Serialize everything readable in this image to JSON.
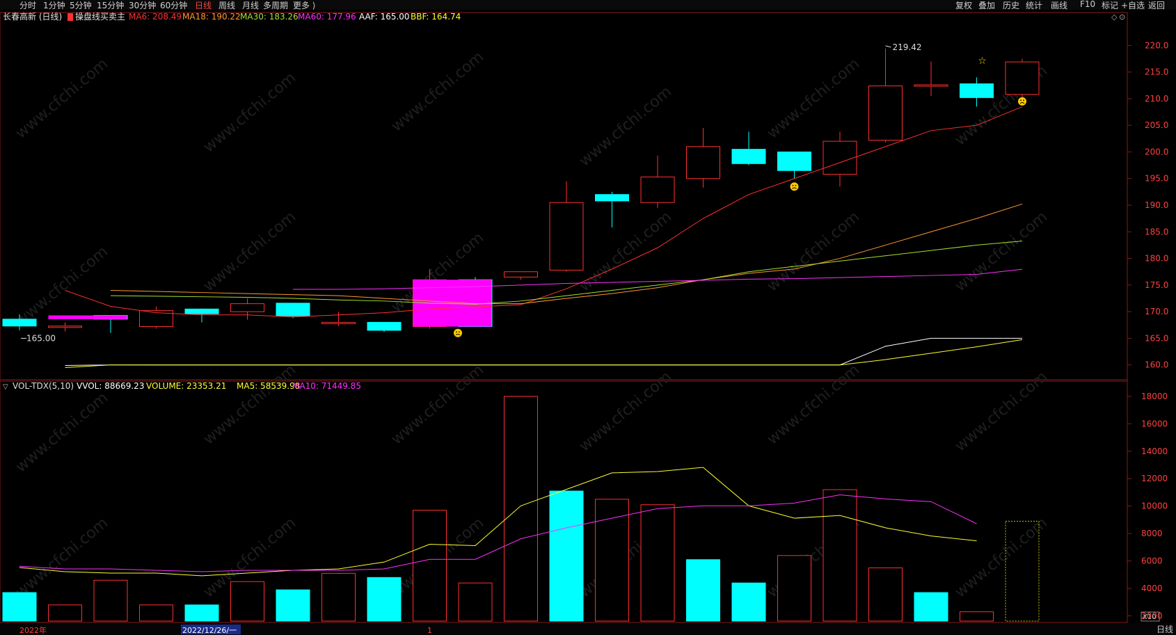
{
  "toolbar": {
    "periods": [
      "分时",
      "1分钟",
      "5分钟",
      "15分钟",
      "30分钟",
      "60分钟",
      "日线",
      "周线",
      "月线",
      "多周期",
      "更多 ⟩"
    ],
    "active": "日线",
    "right_items": [
      "复权",
      "叠加",
      "历史",
      "统计",
      "画线",
      "F10",
      "标记",
      "+自选",
      "返回"
    ]
  },
  "main_legend": {
    "stock": "长春高新 (日线)",
    "indicator": "操盘线买卖主",
    "items": [
      {
        "label": "MA6: 208.49",
        "color": "#ff3030"
      },
      {
        "label": "MA18: 190.22",
        "color": "#ff9a30"
      },
      {
        "label": "MA30: 183.26",
        "color": "#a8e030"
      },
      {
        "label": "MA60: 177.96",
        "color": "#ff30ff"
      },
      {
        "label": "AAF: 165.00",
        "color": "#ffffff"
      },
      {
        "label": "BBF: 164.74",
        "color": "#ffff30"
      }
    ]
  },
  "vol_legend": {
    "name": "VOL-TDX(5,10)",
    "items": [
      {
        "label": "VVOL: 88669.23",
        "color": "#ffffff"
      },
      {
        "label": "VOLUME: 23353.21",
        "color": "#ffff30"
      },
      {
        "label": "MA5: 58539.98",
        "color": "#ffff30"
      },
      {
        "label": "MA10: 71449.85",
        "color": "#ff30ff"
      }
    ]
  },
  "annotations": {
    "high_label": "219.42",
    "low_label": "165.00"
  },
  "watermark": "www.cfchi.com",
  "x_axis": {
    "labels": [
      "2022年",
      "2022/12/26/一",
      "1"
    ]
  },
  "bottom_tag": "日线",
  "scale_tag": "X10",
  "chart_data": [
    {
      "type": "candlestick",
      "ylim": [
        158,
        222
      ],
      "yticks": [
        160.0,
        165.0,
        170.0,
        175.0,
        180.0,
        185.0,
        190.0,
        195.0,
        200.0,
        205.0,
        210.0,
        215.0,
        220.0
      ],
      "candles": [
        {
          "o": 167.3,
          "c": 168.6,
          "h": 169.5,
          "l": 166.5,
          "dir": "down"
        },
        {
          "o": 167.2,
          "c": 167.3,
          "h": 168.0,
          "l": 166.3,
          "dir": "up"
        },
        {
          "o": 169.3,
          "c": 168.6,
          "h": 169.2,
          "l": 166.0,
          "dir": "down"
        },
        {
          "o": 167.2,
          "c": 170.2,
          "h": 171.0,
          "l": 166.8,
          "dir": "up"
        },
        {
          "o": 169.6,
          "c": 170.5,
          "h": 170.6,
          "l": 168.0,
          "dir": "down"
        },
        {
          "o": 170.0,
          "c": 171.5,
          "h": 172.5,
          "l": 168.5,
          "dir": "up"
        },
        {
          "o": 171.6,
          "c": 169.2,
          "h": 171.6,
          "l": 168.8,
          "dir": "down"
        },
        {
          "o": 168.0,
          "c": 168.0,
          "h": 170.0,
          "l": 167.3,
          "dir": "up"
        },
        {
          "o": 168.0,
          "c": 166.5,
          "h": 168.0,
          "l": 166.2,
          "dir": "down"
        },
        {
          "o": 167.2,
          "c": 176.0,
          "h": 178.0,
          "l": 166.8,
          "dir": "up"
        },
        {
          "o": 167.2,
          "c": 176.0,
          "h": 176.5,
          "l": 175.0,
          "dir": "down"
        },
        {
          "o": 177.5,
          "c": 176.5,
          "h": 177.0,
          "l": 176.0,
          "dir": "up"
        },
        {
          "o": 177.8,
          "c": 190.5,
          "h": 194.5,
          "l": 177.5,
          "dir": "up"
        },
        {
          "o": 192.0,
          "c": 190.8,
          "h": 192.5,
          "l": 185.8,
          "dir": "down"
        },
        {
          "o": 190.5,
          "c": 195.3,
          "h": 199.3,
          "l": 189.5,
          "dir": "up"
        },
        {
          "o": 195.0,
          "c": 201.0,
          "h": 204.5,
          "l": 193.3,
          "dir": "up"
        },
        {
          "o": 200.5,
          "c": 197.8,
          "h": 203.8,
          "l": 197.5,
          "dir": "down"
        },
        {
          "o": 200.0,
          "c": 196.5,
          "h": 200.0,
          "l": 195.0,
          "dir": "down"
        },
        {
          "o": 195.8,
          "c": 202.0,
          "h": 203.8,
          "l": 193.5,
          "dir": "up"
        },
        {
          "o": 202.2,
          "c": 212.4,
          "h": 219.4,
          "l": 201.8,
          "dir": "up"
        },
        {
          "o": 212.6,
          "c": 212.5,
          "h": 217.0,
          "l": 210.5,
          "dir": "up"
        },
        {
          "o": 212.8,
          "c": 210.2,
          "h": 214.0,
          "l": 208.5,
          "dir": "down"
        },
        {
          "o": 210.8,
          "c": 216.9,
          "h": 217.5,
          "l": 209.8,
          "dir": "up"
        }
      ],
      "series": [
        {
          "name": "MA6",
          "color": "#ff3030",
          "values": [
            174.0,
            171.0,
            169.8,
            169.4,
            169.4,
            169.0,
            169.4,
            169.8,
            170.5,
            170.9,
            171.3,
            174.3,
            178.0,
            182.0,
            187.5,
            192.0,
            195.0,
            198.0,
            201.0,
            204.0,
            205.0,
            208.49
          ]
        },
        {
          "name": "MA18",
          "color": "#ff9a30",
          "values": [
            174.0,
            173.8,
            173.6,
            173.4,
            173.2,
            173.0,
            172.5,
            172.0,
            171.5,
            171.5,
            172.5,
            173.4,
            174.5,
            176.0,
            177.2,
            178.0,
            180.0,
            182.5,
            185.0,
            187.5,
            190.22
          ]
        },
        {
          "name": "MA30",
          "color": "#a8e030",
          "values": [
            173.0,
            172.9,
            172.8,
            172.7,
            172.5,
            172.2,
            172.0,
            171.6,
            171.4,
            172.0,
            173.0,
            174.0,
            175.0,
            176.0,
            177.5,
            178.5,
            179.5,
            180.5,
            181.5,
            182.5,
            183.26
          ]
        },
        {
          "name": "MA60",
          "color": "#ff30ff",
          "values": [
            174.2,
            174.2,
            174.3,
            174.5,
            174.7,
            175.0,
            175.3,
            175.5,
            175.7,
            175.9,
            176.1,
            176.2,
            176.4,
            176.6,
            176.8,
            177.0,
            177.96
          ]
        },
        {
          "name": "AAF",
          "color": "#ffffff",
          "values": [
            159.9,
            160.0,
            160.0,
            160.0,
            160.0,
            160.0,
            160.0,
            160.0,
            160.0,
            160.0,
            160.0,
            160.0,
            160.0,
            160.0,
            160.0,
            160.0,
            160.0,
            160.0,
            163.5,
            165.0,
            165.0,
            165.0
          ]
        },
        {
          "name": "BBF",
          "color": "#ffff30",
          "values": [
            159.5,
            160.0,
            160.0,
            160.0,
            160.0,
            160.0,
            160.0,
            160.0,
            160.0,
            160.0,
            160.0,
            160.0,
            160.0,
            160.0,
            160.0,
            160.0,
            160.0,
            160.0,
            161.0,
            162.2,
            163.4,
            164.74
          ]
        }
      ]
    },
    {
      "type": "bar",
      "ylim": [
        0,
        18500
      ],
      "yticks": [
        2000,
        4000,
        6000,
        8000,
        10000,
        12000,
        14000,
        16000,
        18000
      ],
      "values": [
        3700,
        2800,
        4600,
        2800,
        2800,
        4500,
        3900,
        5100,
        4800,
        9700,
        4400,
        18000,
        11100,
        10500,
        10100,
        6100,
        4400,
        6400,
        11200,
        5500,
        3700,
        2300
      ],
      "dirs": [
        "down",
        "up",
        "up",
        "up",
        "down",
        "up",
        "down",
        "up",
        "down",
        "up",
        "up",
        "up",
        "down",
        "up",
        "up",
        "down",
        "down",
        "up",
        "up",
        "up",
        "down",
        "up"
      ],
      "current_ghost": 8900,
      "series": [
        {
          "name": "MA5",
          "color": "#ffff30",
          "values": [
            3900,
            3600,
            3500,
            3500,
            3300,
            3500,
            3700,
            3800,
            4300,
            5600,
            5500,
            8400,
            9600,
            10800,
            10900,
            11200,
            8400,
            7500,
            7700,
            6800,
            6200,
            5850
          ]
        },
        {
          "name": "MA10",
          "color": "#ff30ff",
          "values": [
            4000,
            3800,
            3800,
            3700,
            3600,
            3700,
            3700,
            3700,
            3800,
            4500,
            4500,
            6000,
            6800,
            7500,
            8200,
            8400,
            8400,
            8600,
            9200,
            8900,
            8700,
            7100
          ]
        }
      ]
    }
  ]
}
